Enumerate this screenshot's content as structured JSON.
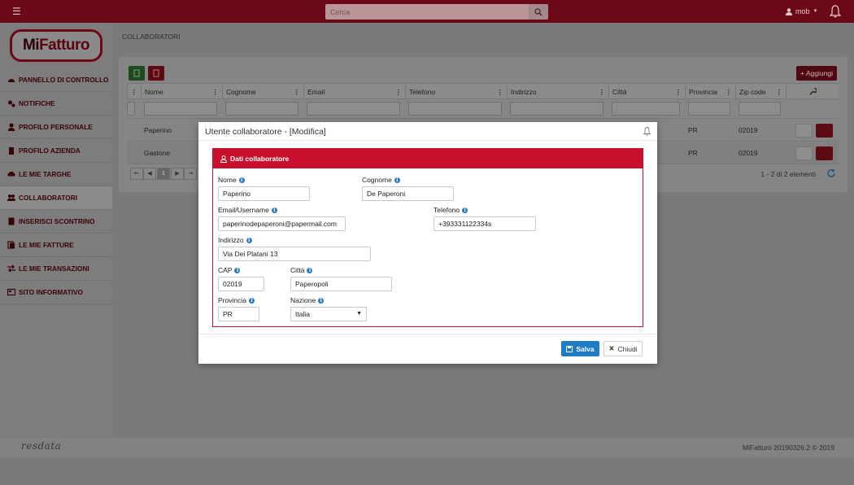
{
  "topbar": {
    "search_placeholder": "Cerca",
    "username": "mob"
  },
  "logo": {
    "part1": "Mi",
    "part2": "Fatturo"
  },
  "sidebar": {
    "items": [
      {
        "label": "PANNELLO DI CONTROLLO",
        "icon": "dashboard-icon"
      },
      {
        "label": "NOTIFICHE",
        "icon": "cogs-icon"
      },
      {
        "label": "PROFILO PERSONALE",
        "icon": "user-icon"
      },
      {
        "label": "PROFILO AZIENDA",
        "icon": "building-icon"
      },
      {
        "label": "LE MIE TARGHE",
        "icon": "car-icon"
      },
      {
        "label": "COLLABORATORI",
        "icon": "users-icon"
      },
      {
        "label": "INSERISCI SCONTRINO",
        "icon": "receipt-icon"
      },
      {
        "label": "LE MIE FATTURE",
        "icon": "invoice-icon"
      },
      {
        "label": "LE MIE TRANSAZIONI",
        "icon": "transactions-icon"
      },
      {
        "label": "SITO INFORMATIVO",
        "icon": "info-site-icon"
      }
    ]
  },
  "main": {
    "breadcrumb": "COLLABORATORI",
    "add_button": "+ Aggiungi",
    "columns": [
      "Nome",
      "Cognome",
      "Email",
      "Telefono",
      "Indirizzo",
      "Città",
      "Provincia",
      "Zip code"
    ],
    "rows": [
      {
        "nome": "Paperino",
        "provincia": "PR",
        "zip": "02019"
      },
      {
        "nome": "Gastone",
        "provincia": "PR",
        "zip": "02019"
      }
    ],
    "pager_current": "1",
    "pager_info": "1 - 2 di 2 elementi"
  },
  "modal": {
    "title": "Utente collaboratore - [Modifica]",
    "section_title": "Dati collaboratore",
    "fields": {
      "nome": {
        "label": "Nome",
        "value": "Paperino"
      },
      "cognome": {
        "label": "Cognome",
        "value": "De Paperoni"
      },
      "email": {
        "label": "Email/Username",
        "value": "paperinodepaperoni@papermail.com"
      },
      "telefono": {
        "label": "Telefono",
        "value": "+393331122334s"
      },
      "indirizzo": {
        "label": "Indirizzo",
        "value": "Via Dei Platani 13"
      },
      "cap": {
        "label": "CAP",
        "value": "02019"
      },
      "citta": {
        "label": "Città",
        "value": "Paperopoli"
      },
      "provincia": {
        "label": "Provincia",
        "value": "PR"
      },
      "nazione": {
        "label": "Nazione",
        "value": "Italia"
      }
    },
    "save_label": "Salva",
    "close_label": "Chiudi"
  },
  "footer": {
    "brand": "resdata",
    "version": "MiFatturo 20190326.2 © 2019"
  },
  "colors": {
    "brand_red": "#c8102e",
    "save_blue": "#1f7bc4",
    "overlay_topbar": "#6b0a16"
  }
}
